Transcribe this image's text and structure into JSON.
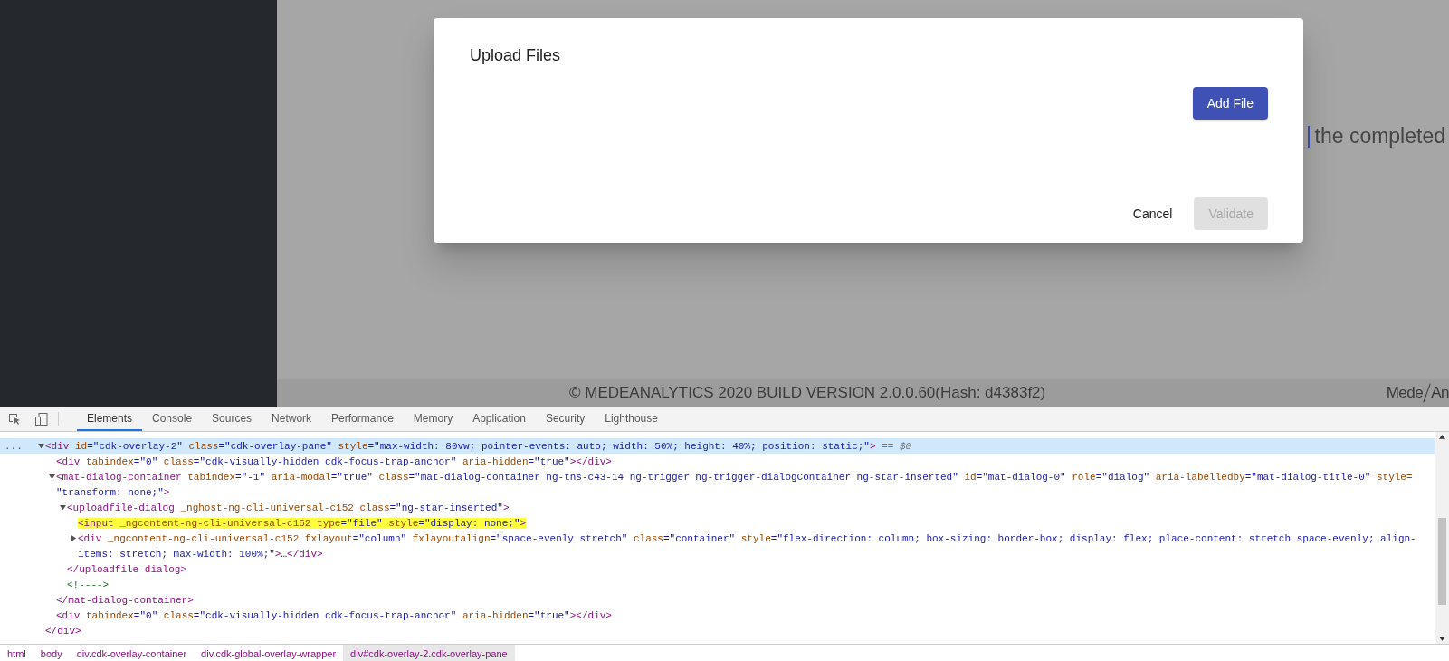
{
  "page": {
    "background_text": "the completed",
    "footer": "© MEDEANALYTICS 2020 BUILD VERSION 2.0.0.60(Hash: d4383f2)",
    "logo": {
      "left": "Mede",
      "right": "An"
    }
  },
  "dialog": {
    "title": "Upload Files",
    "add_button": {
      "label": "Add File",
      "disabled": false
    },
    "actions": [
      {
        "label": "Cancel",
        "kind": "text",
        "disabled": false
      },
      {
        "label": "Validate",
        "kind": "flat",
        "disabled": true
      }
    ]
  },
  "devtools": {
    "tabs": [
      {
        "label": "Elements",
        "selected": true
      },
      {
        "label": "Console",
        "selected": false
      },
      {
        "label": "Sources",
        "selected": false
      },
      {
        "label": "Network",
        "selected": false
      },
      {
        "label": "Performance",
        "selected": false
      },
      {
        "label": "Memory",
        "selected": false
      },
      {
        "label": "Application",
        "selected": false
      },
      {
        "label": "Security",
        "selected": false
      },
      {
        "label": "Lighthouse",
        "selected": false
      }
    ],
    "tree": [
      {
        "gutter": "...",
        "selected": true,
        "highlighted": false,
        "expanded": true,
        "lines": [
          [
            {
              "kind": "tag",
              "text": "<div"
            },
            {
              "kind": "attr",
              "text": " id"
            },
            {
              "kind": "value",
              "text": "=\"cdk-overlay-2\""
            },
            {
              "kind": "attr",
              "text": " class"
            },
            {
              "kind": "value",
              "text": "=\"cdk-overlay-pane\""
            },
            {
              "kind": "attr",
              "text": " style"
            },
            {
              "kind": "value",
              "text": "=\"max-width: 80vw; pointer-events: auto; width: 50%; height: 40%; position: static;\""
            },
            {
              "kind": "tag",
              "text": ">"
            },
            {
              "kind": "meta",
              "text": " == $0"
            }
          ]
        ],
        "closing": [
          {
            "kind": "tag",
            "text": "</div>"
          }
        ],
        "children": [
          {
            "selected": false,
            "highlighted": false,
            "lines": [
              [
                {
                  "kind": "tag",
                  "text": "<div"
                },
                {
                  "kind": "attr",
                  "text": " tabindex"
                },
                {
                  "kind": "value",
                  "text": "=\"0\""
                },
                {
                  "kind": "attr",
                  "text": " class"
                },
                {
                  "kind": "value",
                  "text": "=\"cdk-visually-hidden cdk-focus-trap-anchor\""
                },
                {
                  "kind": "attr",
                  "text": " aria-hidden"
                },
                {
                  "kind": "value",
                  "text": "=\"true\""
                },
                {
                  "kind": "tag",
                  "text": "></div>"
                }
              ]
            ]
          },
          {
            "selected": false,
            "highlighted": false,
            "expanded": true,
            "lines": [
              [
                {
                  "kind": "tag",
                  "text": "<mat-dialog-container"
                },
                {
                  "kind": "attr",
                  "text": " tabindex"
                },
                {
                  "kind": "value",
                  "text": "=\"-1\""
                },
                {
                  "kind": "attr",
                  "text": " aria-modal"
                },
                {
                  "kind": "value",
                  "text": "=\"true\""
                },
                {
                  "kind": "attr",
                  "text": " class"
                },
                {
                  "kind": "value",
                  "text": "=\"mat-dialog-container ng-tns-c43-14 ng-trigger ng-trigger-dialogContainer ng-star-inserted\""
                },
                {
                  "kind": "attr",
                  "text": " id"
                },
                {
                  "kind": "value",
                  "text": "=\"mat-dialog-0\""
                },
                {
                  "kind": "attr",
                  "text": " role"
                },
                {
                  "kind": "value",
                  "text": "=\"dialog\""
                },
                {
                  "kind": "attr",
                  "text": " aria-labelledby"
                },
                {
                  "kind": "value",
                  "text": "=\"mat-dialog-title-0\""
                },
                {
                  "kind": "attr",
                  "text": " style="
                }
              ],
              [
                {
                  "kind": "value",
                  "text": "\"transform: none;\""
                },
                {
                  "kind": "tag",
                  "text": ">"
                }
              ]
            ],
            "closing": [
              {
                "kind": "tag",
                "text": "</mat-dialog-container>"
              }
            ],
            "children": [
              {
                "selected": false,
                "highlighted": false,
                "expanded": true,
                "lines": [
                  [
                    {
                      "kind": "tag",
                      "text": "<uploadfile-dialog"
                    },
                    {
                      "kind": "attr",
                      "text": " _nghost-ng-cli-universal-c152"
                    },
                    {
                      "kind": "attr",
                      "text": " class"
                    },
                    {
                      "kind": "value",
                      "text": "=\"ng-star-inserted\""
                    },
                    {
                      "kind": "tag",
                      "text": ">"
                    }
                  ]
                ],
                "closing": [
                  {
                    "kind": "tag",
                    "text": "</uploadfile-dialog>"
                  }
                ],
                "children": [
                  {
                    "selected": false,
                    "highlighted": true,
                    "lines": [
                      [
                        {
                          "kind": "tag",
                          "text": "<input"
                        },
                        {
                          "kind": "attr",
                          "text": " _ngcontent-ng-cli-universal-c152"
                        },
                        {
                          "kind": "attr",
                          "text": " type"
                        },
                        {
                          "kind": "value",
                          "text": "=\"file\""
                        },
                        {
                          "kind": "attr",
                          "text": " style"
                        },
                        {
                          "kind": "value",
                          "text": "=\"display: none;\""
                        },
                        {
                          "kind": "tag",
                          "text": ">"
                        }
                      ]
                    ]
                  },
                  {
                    "selected": false,
                    "highlighted": false,
                    "expanded": false,
                    "lines": [
                      [
                        {
                          "kind": "tag",
                          "text": "<div"
                        },
                        {
                          "kind": "attr",
                          "text": " _ngcontent-ng-cli-universal-c152"
                        },
                        {
                          "kind": "attr",
                          "text": " fxlayout"
                        },
                        {
                          "kind": "value",
                          "text": "=\"column\""
                        },
                        {
                          "kind": "attr",
                          "text": " fxlayoutalign"
                        },
                        {
                          "kind": "value",
                          "text": "=\"space-evenly stretch\""
                        },
                        {
                          "kind": "attr",
                          "text": " class"
                        },
                        {
                          "kind": "value",
                          "text": "=\"container\""
                        },
                        {
                          "kind": "attr",
                          "text": " style"
                        },
                        {
                          "kind": "value",
                          "text": "=\"flex-direction: column; box-sizing: border-box; display: flex; place-content: stretch space-evenly; align-"
                        }
                      ],
                      [
                        {
                          "kind": "value",
                          "text": "items: stretch; max-width: 100%;\""
                        },
                        {
                          "kind": "tag",
                          "text": ">"
                        },
                        {
                          "kind": "text",
                          "text": "…"
                        },
                        {
                          "kind": "tag",
                          "text": "</div>"
                        }
                      ]
                    ]
                  }
                ]
              },
              {
                "selected": false,
                "highlighted": false,
                "lines": [
                  [
                    {
                      "kind": "comment",
                      "text": "<!---->"
                    }
                  ]
                ]
              }
            ]
          },
          {
            "selected": false,
            "highlighted": false,
            "lines": [
              [
                {
                  "kind": "tag",
                  "text": "<div"
                },
                {
                  "kind": "attr",
                  "text": " tabindex"
                },
                {
                  "kind": "value",
                  "text": "=\"0\""
                },
                {
                  "kind": "attr",
                  "text": " class"
                },
                {
                  "kind": "value",
                  "text": "=\"cdk-visually-hidden cdk-focus-trap-anchor\""
                },
                {
                  "kind": "attr",
                  "text": " aria-hidden"
                },
                {
                  "kind": "value",
                  "text": "=\"true\""
                },
                {
                  "kind": "tag",
                  "text": "></div>"
                }
              ]
            ]
          }
        ]
      }
    ],
    "breadcrumbs": [
      {
        "label": "html",
        "selected": false
      },
      {
        "label": "body",
        "selected": false
      },
      {
        "label": "div.cdk-overlay-container",
        "selected": false
      },
      {
        "label": "div.cdk-global-overlay-wrapper",
        "selected": false
      },
      {
        "label": "div#cdk-overlay-2.cdk-overlay-pane",
        "selected": true
      }
    ]
  }
}
